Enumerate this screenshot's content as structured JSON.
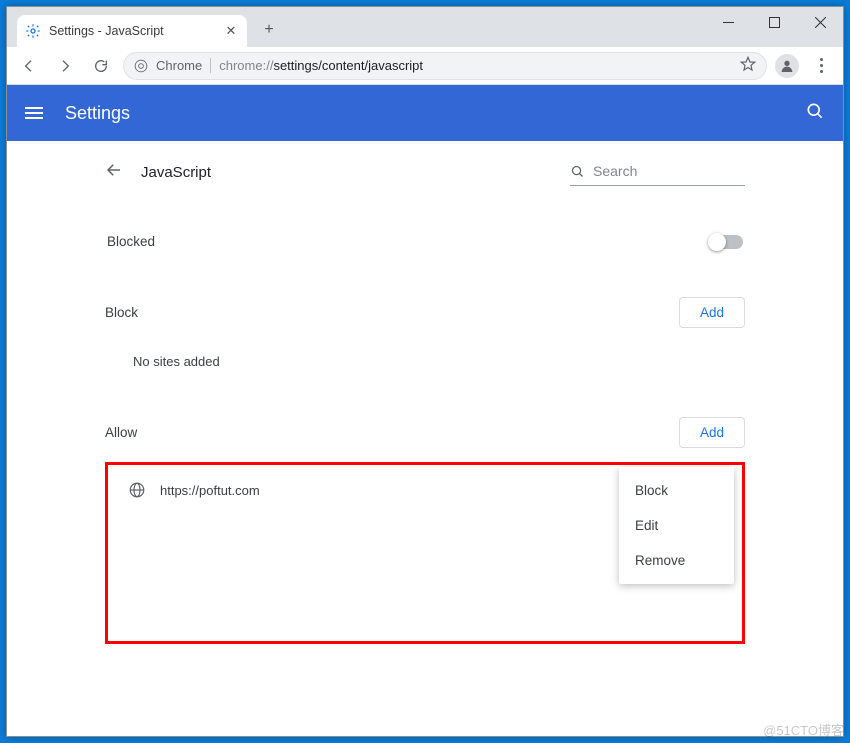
{
  "window": {
    "tab_title": "Settings - JavaScript"
  },
  "toolbar": {
    "chrome_label": "Chrome",
    "url_prefix": "chrome://",
    "url_rest": "settings/content/javascript"
  },
  "settings_header": {
    "title": "Settings"
  },
  "page": {
    "title": "JavaScript",
    "search_placeholder": "Search",
    "blocked_label": "Blocked",
    "block_section_label": "Block",
    "allow_section_label": "Allow",
    "add_button": "Add",
    "no_sites_text": "No sites added",
    "allow_sites": [
      {
        "url": "https://poftut.com"
      }
    ],
    "context_menu": {
      "block": "Block",
      "edit": "Edit",
      "remove": "Remove"
    }
  },
  "watermark": "@51CTO博客"
}
